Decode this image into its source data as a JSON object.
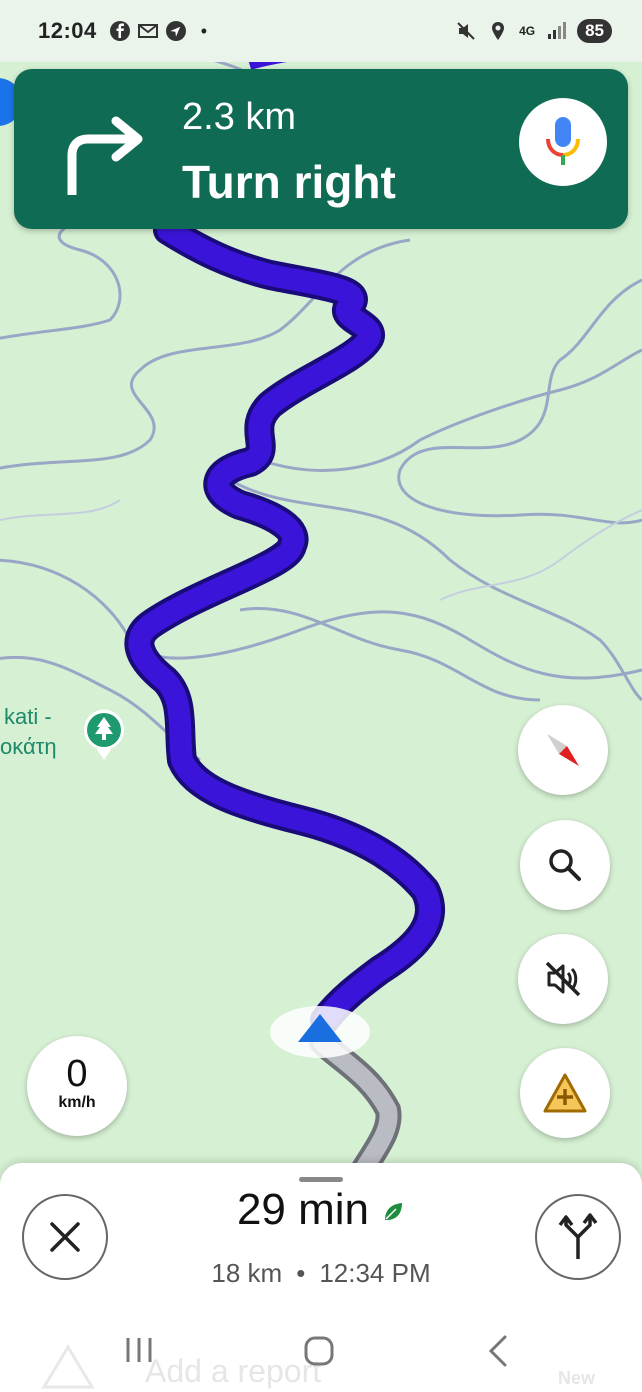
{
  "status_bar": {
    "time": "12:04",
    "network": "4G",
    "battery": "85"
  },
  "navigation": {
    "distance": "2.3 km",
    "instruction": "Turn right",
    "maneuver_icon": "turn-right-icon",
    "voice_icon": "mic-icon"
  },
  "map": {
    "poi_label_line1": "kati -",
    "poi_label_line2": "οκάτη",
    "poi_icon": "tree-icon",
    "route_color": "#3b14d9",
    "route_traveled_color": "#b9bcc2",
    "land_color": "#d6f0d3",
    "road_color": "#9aa6c6"
  },
  "controls": {
    "compass_icon": "compass-icon",
    "search_icon": "search-icon",
    "sound_icon": "sound-off-icon",
    "report_icon": "add-report-icon"
  },
  "speedometer": {
    "value": "0",
    "unit": "km/h"
  },
  "trip": {
    "eta": "29 min",
    "distance": "18 km",
    "separator": "•",
    "arrival": "12:34 PM"
  },
  "bottom_hidden": {
    "label": "Add a report",
    "badge": "New"
  },
  "colors": {
    "banner": "#0f6b53",
    "eco_leaf": "#1e8e3e"
  }
}
